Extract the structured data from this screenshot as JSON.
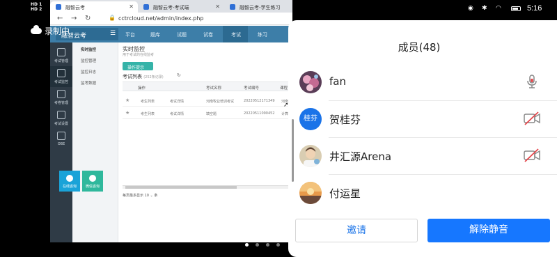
{
  "status_bar": {
    "hd1": "HD 1",
    "hd2": "HD 2",
    "time": "5:16"
  },
  "recording": {
    "label": "录制中"
  },
  "browser": {
    "tabs": [
      {
        "title": "融智云考"
      },
      {
        "title": "融智云考-考试端"
      },
      {
        "title": "融智云考-学生练习"
      }
    ],
    "url": "cctrcloud.net/admin/index.php"
  },
  "app": {
    "logo": "融智云考",
    "top_nav": [
      "平台",
      "题库",
      "试题",
      "试卷",
      "考试",
      "练习"
    ],
    "top_nav_selected": 4,
    "left_sidebar": [
      {
        "label": "考试管理",
        "icon": "exam-icon"
      },
      {
        "label": "考试监控",
        "icon": "monitor-icon"
      },
      {
        "label": "考卷管理",
        "icon": "paper-icon"
      },
      {
        "label": "考试设置",
        "icon": "settings-icon"
      },
      {
        "label": "OBE",
        "icon": "obe-icon"
      }
    ],
    "left_sidebar_selected": 1,
    "sub_menu": [
      "实时监控",
      "监控管理",
      "监控日志",
      "监考数据"
    ],
    "sub_menu_selected": 0,
    "page_title": "实时监控",
    "page_subtitle": "用于考试的在线监考",
    "action_button": "操作提示",
    "list_title": "考试列表",
    "list_count": "(252条记录)",
    "table_headers": [
      "操作",
      "考试名称",
      "考试编号",
      "课程"
    ],
    "rows": [
      {
        "op1": "考生列表",
        "op2": "考试详情",
        "name": "河南牧业培训考试",
        "code": "20220512171349",
        "course": "河南"
      },
      {
        "op1": "考生列表",
        "op2": "考试详情",
        "name": "填空题",
        "code": "20220511090452",
        "course": "计算"
      }
    ],
    "pager_text": "每页最多显示 10",
    "pager_unit": "条",
    "quick_buttons": [
      "在线咨询",
      "微信咨询"
    ]
  },
  "members_panel": {
    "title": "成员(48)",
    "members": [
      {
        "name": "fan",
        "avatar": "photo",
        "status_icon": "mic-icon"
      },
      {
        "name": "贺桂芬",
        "avatar": "桂芬",
        "status_icon": "camera-off-icon"
      },
      {
        "name": "井汇源Arena",
        "avatar": "photo",
        "status_icon": "camera-off-icon"
      },
      {
        "name": "付运星",
        "avatar": "photo",
        "status_icon": ""
      }
    ],
    "invite_label": "邀请",
    "unmute_label": "解除静音",
    "colors": {
      "accent": "#1677ff",
      "mic_muted": "#e5484d"
    }
  }
}
